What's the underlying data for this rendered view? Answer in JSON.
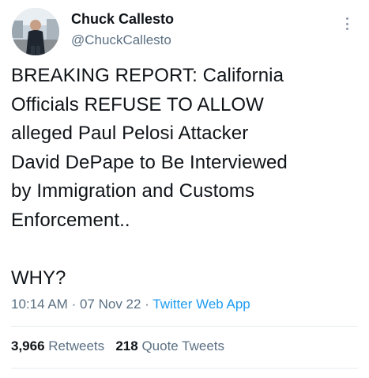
{
  "author": {
    "name": "Chuck Callesto",
    "handle": "@ChuckCallesto"
  },
  "tweet": {
    "text": "BREAKING REPORT: California\nOfficials REFUSE TO ALLOW\nalleged Paul Pelosi Attacker\nDavid DePape to Be Interviewed\nby Immigration and Customs\nEnforcement..",
    "question": "WHY?",
    "time": "10:14 AM",
    "date": "07 Nov 22",
    "source": "Twitter Web App",
    "separator": "·"
  },
  "stats": {
    "retweets_count": "3,966",
    "retweets_label": "Retweets",
    "quotes_count": "218",
    "quotes_label": "Quote Tweets"
  },
  "icons": {
    "more": "more-vertical-icon"
  },
  "colors": {
    "text": "#0f1419",
    "secondary": "#5b7083",
    "link": "#1d9bf0",
    "divider": "#e6ecf0"
  }
}
